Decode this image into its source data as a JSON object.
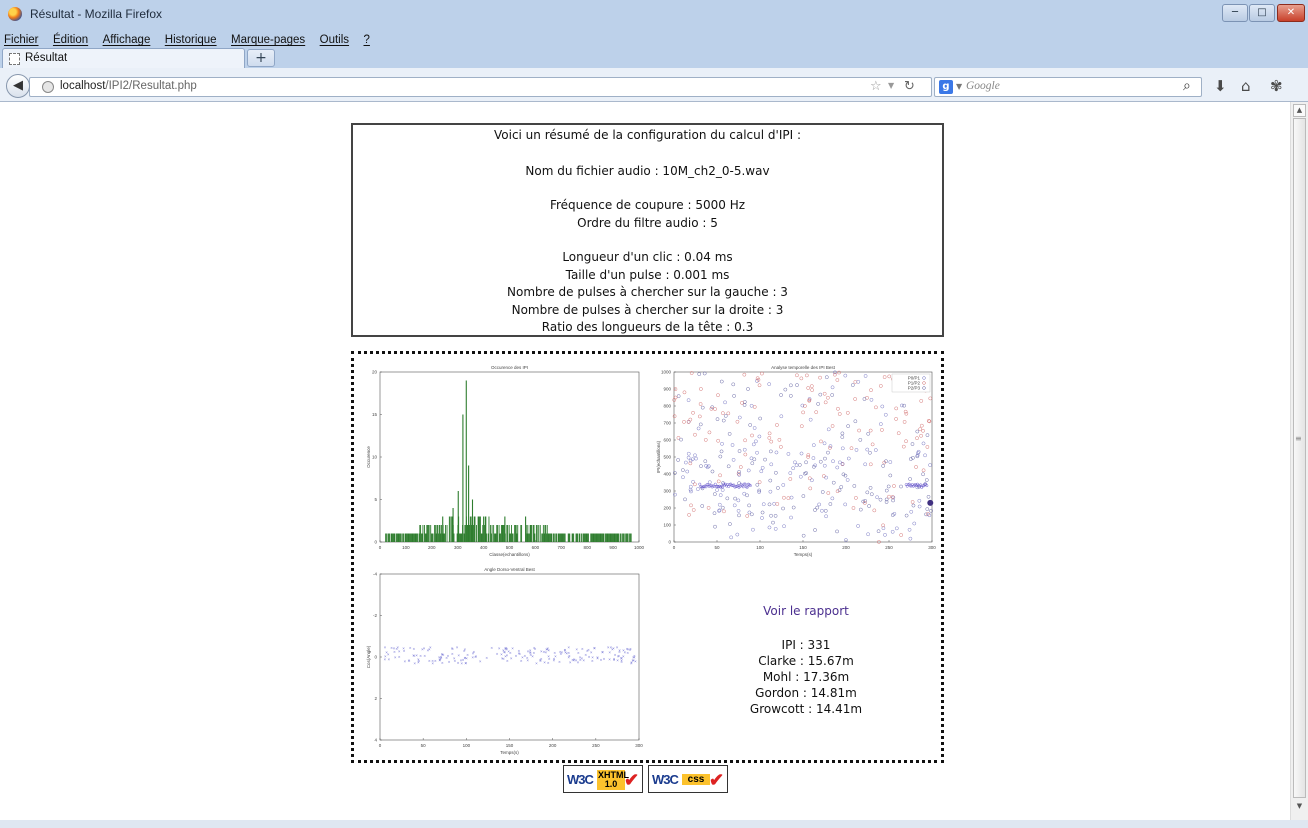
{
  "window": {
    "title": "Résultat - Mozilla Firefox",
    "buttons": {
      "minimize": "─",
      "maximize": "□",
      "close": "✕"
    }
  },
  "menubar": [
    "Fichier",
    "Édition",
    "Affichage",
    "Historique",
    "Marque-pages",
    "Outils",
    "?"
  ],
  "tabs": [
    {
      "label": "Résultat"
    }
  ],
  "newtab_label": "+",
  "nav": {
    "url_host": "localhost",
    "url_path": "/IPI2/Resultat.php",
    "search_placeholder": "Google",
    "search_engine": "g"
  },
  "config": {
    "heading": "Voici un résumé de la configuration du calcul d'IPI :",
    "filename": "Nom du fichier audio : 10M_ch2_0-5.wav",
    "cutoff": "Fréquence de coupure : 5000 Hz",
    "filter_order": "Ordre du filtre audio : 5",
    "click_length": "Longueur d'un clic : 0.04 ms",
    "pulse_size": "Taille d'un pulse : 0.001 ms",
    "pulses_left": "Nombre de pulses à chercher sur la gauche : 3",
    "pulses_right": "Nombre de pulses à chercher sur la droite : 3",
    "head_ratio": "Ratio des longueurs de la tête : 0.3"
  },
  "results": {
    "report_link": "Voir le rapport",
    "ipi": "IPI : 331",
    "clarke": "Clarke : 15.67m",
    "mohl": "Mohl : 17.36m",
    "gordon": "Gordon : 14.81m",
    "growcott": "Growcott : 14.41m"
  },
  "badges": {
    "xhtml_w3c": "W3C",
    "xhtml_top": "XHTML",
    "xhtml_bottom": "1.0",
    "css_w3c": "W3C",
    "css_tag": "css"
  },
  "chart_data": [
    {
      "type": "bar",
      "title": "Occurence des IPI",
      "xlabel": "Classe(echantillons)",
      "ylabel": "Occurence",
      "xlim": [
        0,
        1000
      ],
      "ylim": [
        0,
        20
      ],
      "xticks": [
        "0",
        "100",
        "200",
        "300",
        "400",
        "500",
        "600",
        "700",
        "800",
        "900",
        "1000"
      ],
      "yticks": [
        "0",
        "5",
        "10",
        "15",
        "20"
      ],
      "color": "#2e7d2e",
      "peaks": [
        {
          "x": 331,
          "y": 19
        },
        {
          "x": 318,
          "y": 15
        },
        {
          "x": 340,
          "y": 9
        },
        {
          "x": 300,
          "y": 6
        },
        {
          "x": 355,
          "y": 5
        },
        {
          "x": 280,
          "y": 4
        },
        {
          "x": 240,
          "y": 3
        },
        {
          "x": 480,
          "y": 3
        },
        {
          "x": 560,
          "y": 3
        }
      ],
      "baseline_range": [
        20,
        970
      ]
    },
    {
      "type": "scatter",
      "title": "Analyse temporelle des IPI Best",
      "xlabel": "Temps(s)",
      "ylabel": "IPI(echantillons)",
      "xlim": [
        0,
        300
      ],
      "ylim": [
        0,
        1000
      ],
      "xticks": [
        "0",
        "50",
        "100",
        "150",
        "200",
        "250",
        "300"
      ],
      "yticks": [
        "0",
        "100",
        "200",
        "300",
        "400",
        "500",
        "600",
        "700",
        "800",
        "900",
        "1000"
      ],
      "series": [
        {
          "name": "P0/P1",
          "color": "#7070c0"
        },
        {
          "name": "P1/P2",
          "color": "#d06a6a"
        },
        {
          "name": "P2/P3",
          "color": "#6060a0"
        }
      ],
      "dense_band": {
        "y": 331,
        "x_ranges": [
          [
            30,
            90
          ],
          [
            270,
            295
          ]
        ]
      }
    },
    {
      "type": "scatter",
      "title": "Angle Dorso-Ventral Best",
      "xlabel": "Temps(s)",
      "ylabel": "Cos(Angle)",
      "xlim": [
        0,
        300
      ],
      "ylim": [
        -5,
        5
      ],
      "xticks": [
        "0",
        "50",
        "100",
        "150",
        "200",
        "250",
        "300"
      ],
      "yticks": [
        "4",
        "2",
        "0",
        "-2",
        "-4"
      ],
      "color": "#7a7ad6",
      "center": 0.1,
      "spread": 0.5
    }
  ]
}
